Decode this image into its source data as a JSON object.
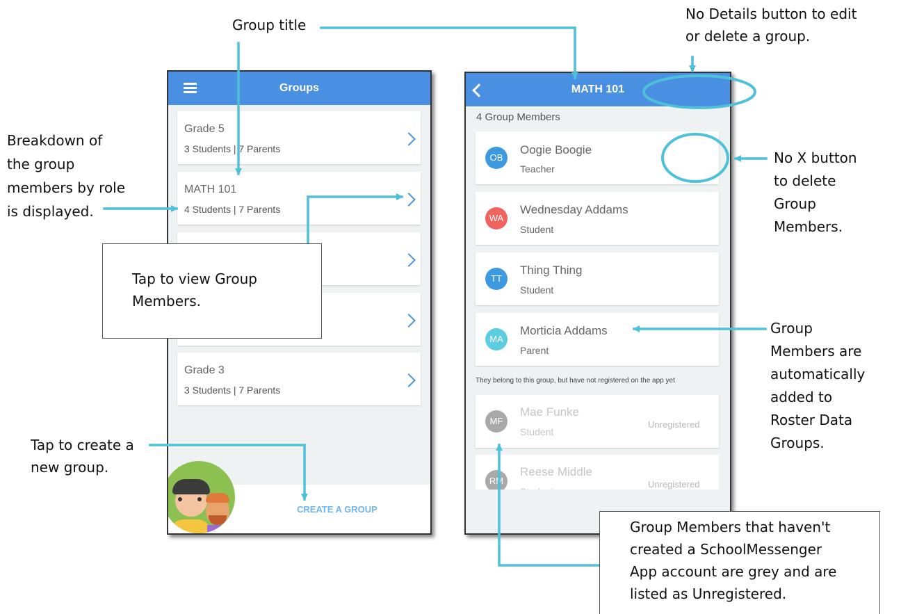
{
  "annotations": {
    "group_title": "Group title",
    "no_details_line1": "No Details button to edit",
    "no_details_line2": "or delete a group.",
    "breakdown_lines": [
      "Breakdown of",
      "the group",
      "members by role",
      "is displayed."
    ],
    "no_x_lines": [
      "No X button",
      "to delete",
      "Group",
      "Members."
    ],
    "tap_view_lines": [
      "Tap to view Group",
      "Members."
    ],
    "auto_added_lines": [
      "Group",
      "Members are",
      "automatically",
      "added to",
      "Roster Data",
      "Groups."
    ],
    "tap_create_lines": [
      "Tap to create a",
      "new group."
    ],
    "unregistered_note_lines": [
      "Group Members that haven't",
      "created a SchoolMessenger",
      "App account are grey and are",
      "listed as Unregistered."
    ]
  },
  "groups_screen": {
    "title": "Groups",
    "menu_icon": "hamburger-menu-icon",
    "groups": [
      {
        "name": "Grade 5",
        "breakdown": "3 Students | 7 Parents"
      },
      {
        "name": "MATH 101",
        "breakdown": "4 Students | 7 Parents"
      },
      {
        "name": "",
        "breakdown": ""
      },
      {
        "name": "",
        "breakdown": ""
      },
      {
        "name": "Grade 3",
        "breakdown": "3 Students | 7 Parents"
      }
    ],
    "create_button": "CREATE A GROUP"
  },
  "members_screen": {
    "title": "MATH 101",
    "back_icon": "back-chevron-icon",
    "count_label": "4 Group Members",
    "members": [
      {
        "initials": "OB",
        "name": "Oogie Boogie",
        "role": "Teacher",
        "color": "#3d9ae0"
      },
      {
        "initials": "WA",
        "name": "Wednesday Addams",
        "role": "Student",
        "color": "#f0635f"
      },
      {
        "initials": "TT",
        "name": "Thing Thing",
        "role": "Student",
        "color": "#3d9ae0"
      },
      {
        "initials": "MA",
        "name": "Morticia Addams",
        "role": "Parent",
        "color": "#5ccde0"
      }
    ],
    "unregistered_header": "They belong to this group, but have not registered on the app yet",
    "unregistered_members": [
      {
        "initials": "MF",
        "name": "Mae Funke",
        "role": "Student",
        "status": "Unregistered",
        "color": "#a9a9a9"
      },
      {
        "initials": "RM",
        "name": "Reese Middle",
        "role": "Student",
        "status": "Unregistered",
        "color": "#a9a9a9"
      }
    ]
  },
  "colors": {
    "app_blue": "#4a90e2",
    "callout_line": "#4ec0d8",
    "screen_bg": "#eef2f3"
  }
}
